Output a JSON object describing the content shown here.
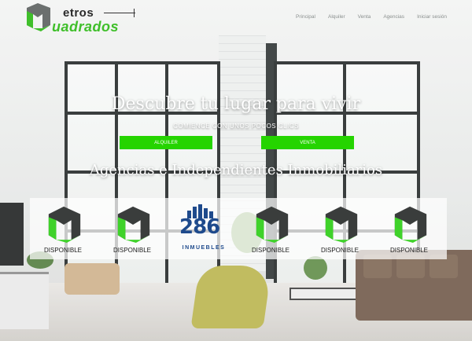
{
  "logo": {
    "word1": "etros",
    "word2": "uadrados"
  },
  "nav": {
    "items": [
      "Principal",
      "Alquiler",
      "Venta",
      "Agencias",
      "Iniciar sesión"
    ]
  },
  "hero": {
    "title": "Descubre tu lugar para vivir",
    "subtitle": "COMIENCE CON UNOS POCOS CLICS",
    "btn_alquiler": "ALQUILER",
    "btn_venta": "VENTA"
  },
  "agencies": {
    "title": "Agencias e Independientes Inmobiliarios",
    "items": [
      {
        "label": "DISPONIBLE"
      },
      {
        "label": "DISPONIBLE"
      },
      {
        "label": "286 INMUEBLES",
        "num": "286",
        "sub": "INMUEBLES"
      },
      {
        "label": "DISPONIBLE"
      },
      {
        "label": "DISPONIBLE"
      },
      {
        "label": "DISPONIBLE"
      }
    ]
  },
  "colors": {
    "accent": "#25d400",
    "logo_green": "#3fbf2a",
    "brand_blue": "#1e4a8c"
  }
}
